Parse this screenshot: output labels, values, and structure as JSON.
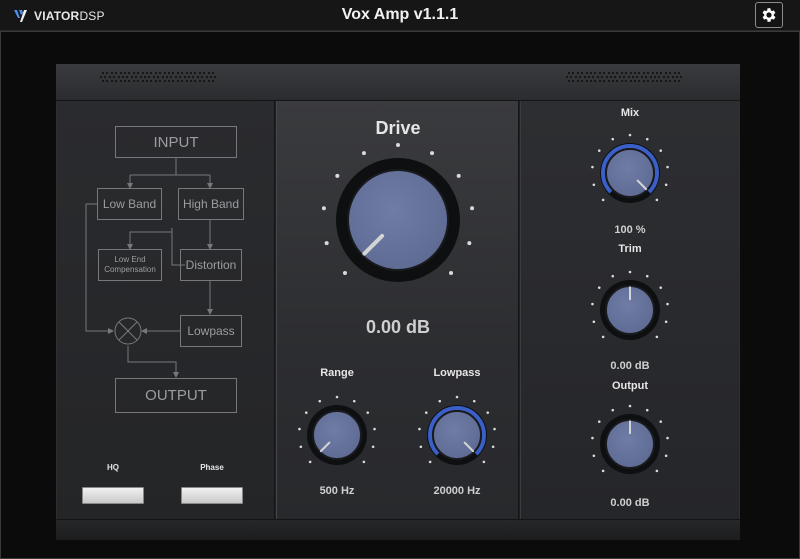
{
  "app": {
    "logo_main": "VIATOR",
    "logo_sub": "DSP",
    "title": "Vox Amp v1.1.1",
    "settings_icon": "gear-icon"
  },
  "diagram": {
    "input": "INPUT",
    "low_band": "Low Band",
    "high_band": "High Band",
    "low_end_line1": "Low End",
    "low_end_line2": "Compensation",
    "distortion": "Distortion",
    "lowpass": "Lowpass",
    "output": "OUTPUT",
    "mixer_icon": "sum-icon"
  },
  "toggles": {
    "hq_label": "HQ",
    "hq_on": false,
    "phase_label": "Phase",
    "phase_on": false
  },
  "knobs": {
    "drive": {
      "label": "Drive",
      "value": "0.00 dB",
      "position": 0.0
    },
    "range": {
      "label": "Range",
      "value": "500 Hz",
      "position": 0.0
    },
    "lowpass": {
      "label": "Lowpass",
      "value": "20000 Hz",
      "position": 1.0
    },
    "mix": {
      "label": "Mix",
      "value": "100 %",
      "position": 1.0
    },
    "trim": {
      "label": "Trim",
      "value": "0.00 dB",
      "position": 0.5
    },
    "output": {
      "label": "Output",
      "value": "0.00 dB",
      "position": 0.5
    }
  },
  "colors": {
    "accent": "#3a5fc8",
    "knob_face": "#5d6a92",
    "text": "#e6e6e6"
  }
}
